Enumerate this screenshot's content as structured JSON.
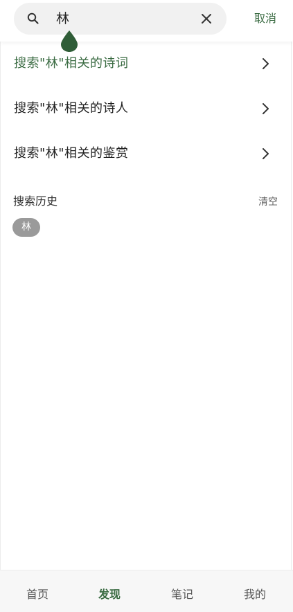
{
  "header": {
    "search_value": "林",
    "cancel_label": "取消",
    "icons": {
      "search": "search-icon",
      "clear": "close-icon"
    }
  },
  "suggestions": [
    {
      "label": "搜索\"林\"相关的诗词",
      "active": true
    },
    {
      "label": "搜索\"林\"相关的诗人",
      "active": false
    },
    {
      "label": "搜索\"林\"相关的鉴赏",
      "active": false
    }
  ],
  "history": {
    "title": "搜索历史",
    "clear_label": "清空",
    "items": [
      "林"
    ]
  },
  "nav": {
    "items": [
      {
        "label": "首页"
      },
      {
        "label": "发现"
      },
      {
        "label": "笔记"
      },
      {
        "label": "我的"
      }
    ],
    "active_index": 1
  },
  "colors": {
    "accent": "#3a6b42",
    "chip_bg": "#9a9a9a",
    "search_bg": "#f1f1f1"
  }
}
